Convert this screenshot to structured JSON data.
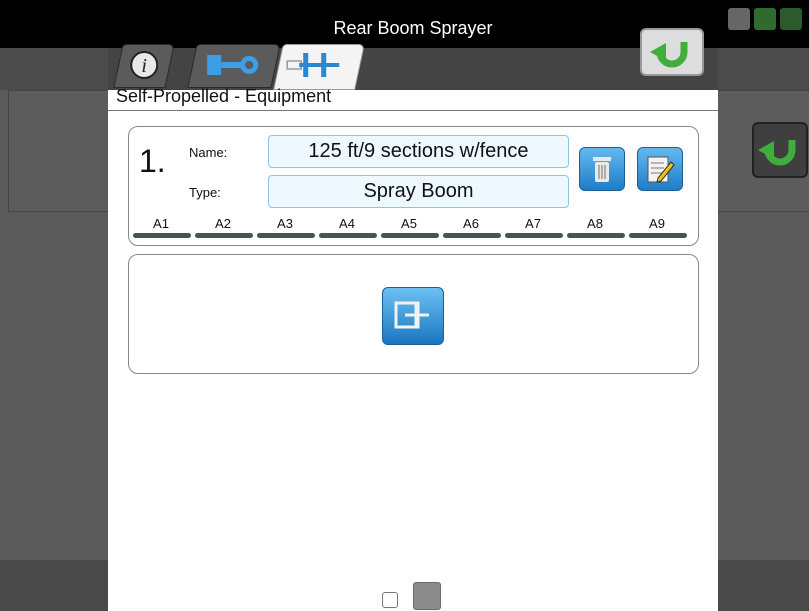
{
  "window": {
    "title": "Rear Boom Sprayer"
  },
  "tabs": [
    {
      "id": "info",
      "icon": "info-icon"
    },
    {
      "id": "equipment-connection",
      "icon": "hitch-wrench-icon"
    },
    {
      "id": "boom-sections",
      "icon": "boom-sections-icon",
      "active": true
    }
  ],
  "subtitle": "Self-Propelled - Equipment",
  "equipment": {
    "number": "1.",
    "name_label": "Name:",
    "name_value": "125 ft/9 sections w/fence",
    "type_label": "Type:",
    "type_value": "Spray Boom",
    "sections": [
      "A1",
      "A2",
      "A3",
      "A4",
      "A5",
      "A6",
      "A7",
      "A8",
      "A9"
    ]
  },
  "icons": {
    "delete": "trash-icon",
    "edit": "edit-notepad-icon",
    "add": "add-equipment-icon",
    "return": "return-arrow-icon"
  },
  "colors": {
    "accent_blue": "#2a8ad6",
    "return_green": "#3fae3a",
    "field_border": "#8fc3df",
    "section_bar": "#46554f"
  },
  "pagination": {
    "pages": 2,
    "current": 2
  }
}
